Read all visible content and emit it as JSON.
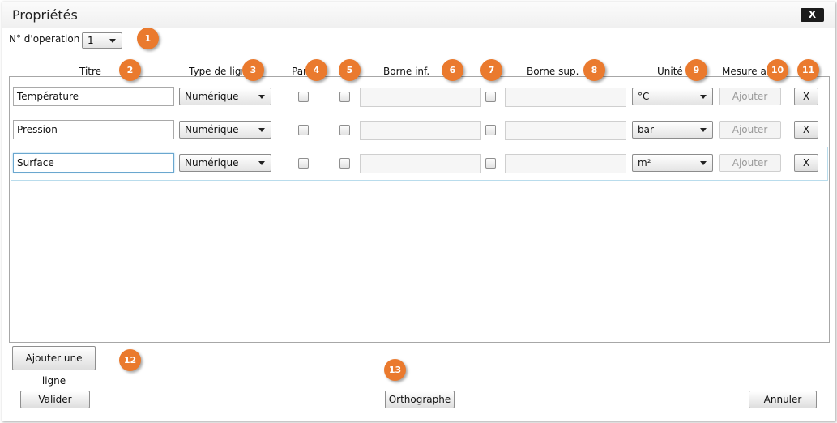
{
  "window": {
    "title": "Propriétés",
    "close_label": "X"
  },
  "operation": {
    "label": "N° d'operation",
    "value": "1"
  },
  "headers": {
    "titre": "Titre",
    "type": "Type de ligne",
    "par": "Par",
    "borne_inf": "Borne inf.",
    "borne_sup": "Borne sup.",
    "unite": "Unité",
    "mesure": "Mesure au"
  },
  "rows": [
    {
      "titre": "Température",
      "type": "Numérique",
      "unite": "°C",
      "ajouter": "Ajouter",
      "delete": "X"
    },
    {
      "titre": "Pression",
      "type": "Numérique",
      "unite": "bar",
      "ajouter": "Ajouter",
      "delete": "X"
    },
    {
      "titre": "Surface",
      "type": "Numérique",
      "unite": "m²",
      "ajouter": "Ajouter",
      "delete": "X"
    }
  ],
  "actions": {
    "add_row": "Ajouter une ligne",
    "validate": "Valider",
    "spellcheck": "Orthographe",
    "cancel": "Annuler"
  },
  "badges": [
    "1",
    "2",
    "3",
    "4",
    "5",
    "6",
    "7",
    "8",
    "9",
    "10",
    "11",
    "12",
    "13"
  ],
  "colors": {
    "badge": "#ea7a2e",
    "titlebar_close": "#1b1b1b",
    "selection_border": "#b9dcec"
  }
}
